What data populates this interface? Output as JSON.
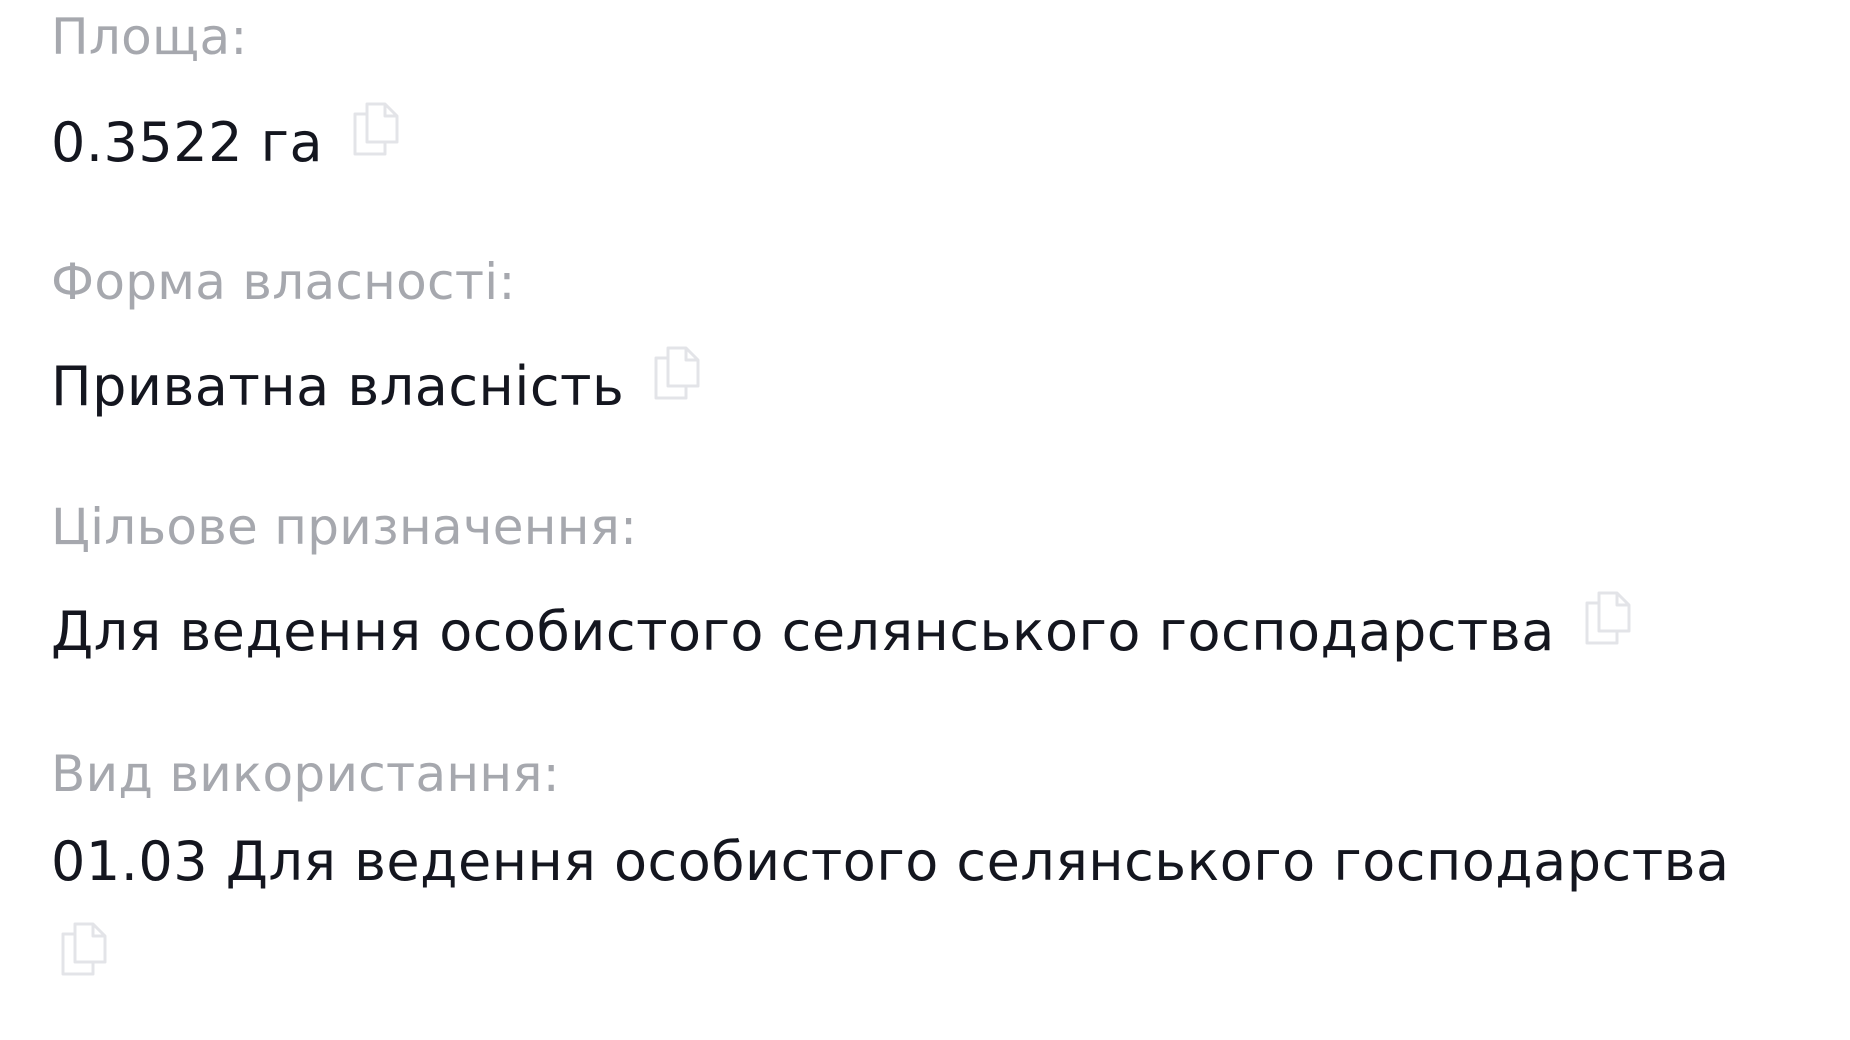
{
  "fields": {
    "area": {
      "label": "Площа:",
      "value": "0.3522 га",
      "copy_icon": "copy-icon"
    },
    "ownership": {
      "label": "Форма власності:",
      "value": "Приватна власність",
      "copy_icon": "copy-icon"
    },
    "purpose": {
      "label": "Цільове призначення:",
      "value": "Для ведення особистого селянського господарства",
      "copy_icon": "copy-icon"
    },
    "usage": {
      "label": "Вид використання:",
      "value": "01.03 Для ведення особистого селянського господарства",
      "copy_icon": "copy-icon"
    }
  },
  "colors": {
    "label": "#a6a8ae",
    "value": "#14161f",
    "icon": "#e3e4e8",
    "background": "#ffffff"
  }
}
